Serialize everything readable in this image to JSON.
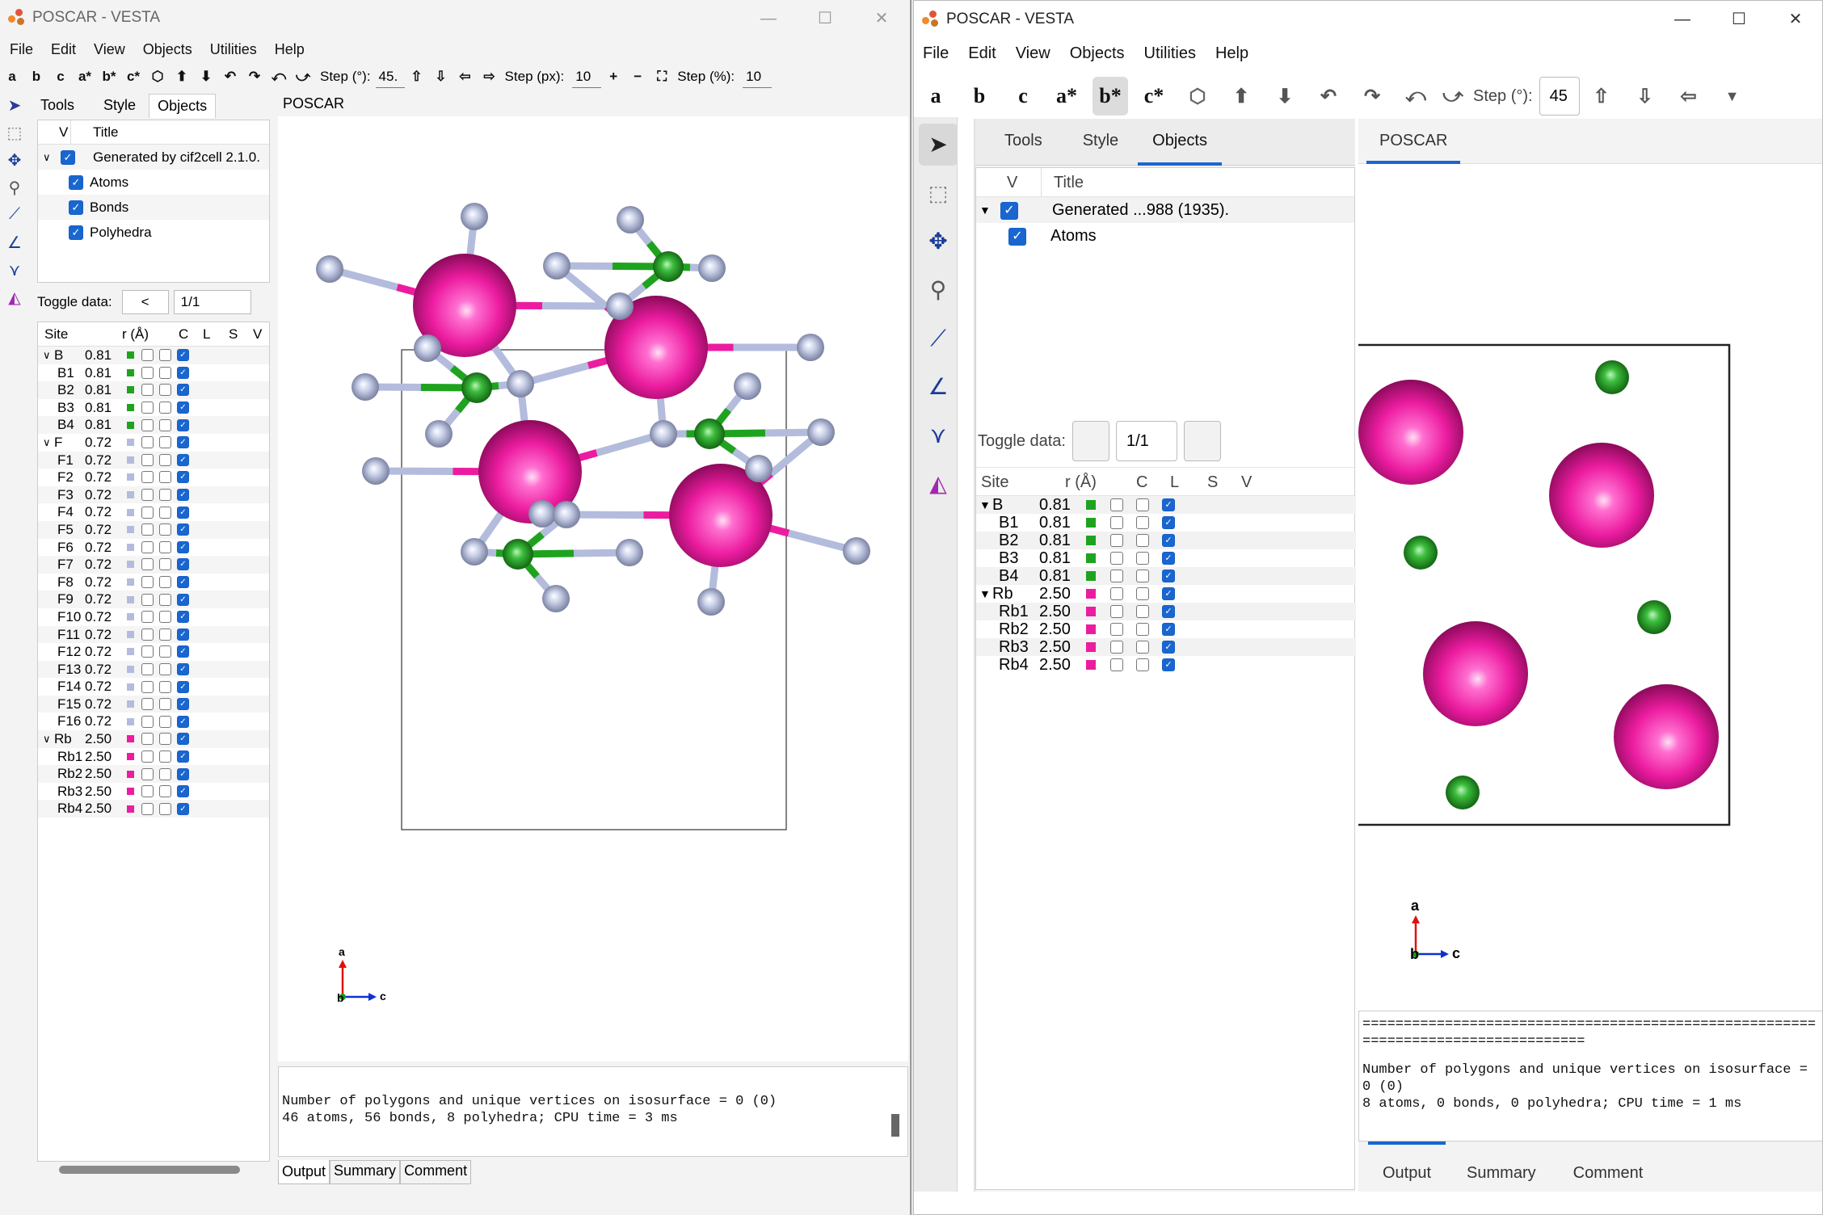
{
  "left": {
    "title": "POSCAR - VESTA",
    "menu": [
      "File",
      "Edit",
      "View",
      "Objects",
      "Utilities",
      "Help"
    ],
    "toolbar": {
      "axes": [
        "a",
        "b",
        "c",
        "a*",
        "b*",
        "c*"
      ],
      "step_deg_label": "Step (°):",
      "step_deg_value": "45.",
      "step_px_label": "Step (px):",
      "step_px_value": "10",
      "step_pct_label": "Step (%):",
      "step_pct_value": "10"
    },
    "tabs": [
      "Tools",
      "Style",
      "Objects"
    ],
    "objects_header": {
      "v": "V",
      "title": "Title"
    },
    "objects": [
      {
        "label": "Generated by cif2cell 2.1.0."
      },
      {
        "label": "Atoms"
      },
      {
        "label": "Bonds"
      },
      {
        "label": "Polyhedra"
      }
    ],
    "toggle_label": "Toggle data:",
    "toggle_prev": "<",
    "toggle_value": "1/1",
    "site_header": {
      "site": "Site",
      "r": "r (Å)",
      "c": "C",
      "l": "L",
      "s": "S",
      "v": "V"
    },
    "sites": [
      {
        "name": "B",
        "r": "0.81",
        "group": true,
        "color": "#1fa31f"
      },
      {
        "name": "B1",
        "r": "0.81",
        "color": "#1fa31f"
      },
      {
        "name": "B2",
        "r": "0.81",
        "color": "#1fa31f"
      },
      {
        "name": "B3",
        "r": "0.81",
        "color": "#1fa31f"
      },
      {
        "name": "B4",
        "r": "0.81",
        "color": "#1fa31f"
      },
      {
        "name": "F",
        "r": "0.72",
        "group": true,
        "color": "#b3bcdc"
      },
      {
        "name": "F1",
        "r": "0.72",
        "color": "#b3bcdc"
      },
      {
        "name": "F2",
        "r": "0.72",
        "color": "#b3bcdc"
      },
      {
        "name": "F3",
        "r": "0.72",
        "color": "#b3bcdc"
      },
      {
        "name": "F4",
        "r": "0.72",
        "color": "#b3bcdc"
      },
      {
        "name": "F5",
        "r": "0.72",
        "color": "#b3bcdc"
      },
      {
        "name": "F6",
        "r": "0.72",
        "color": "#b3bcdc"
      },
      {
        "name": "F7",
        "r": "0.72",
        "color": "#b3bcdc"
      },
      {
        "name": "F8",
        "r": "0.72",
        "color": "#b3bcdc"
      },
      {
        "name": "F9",
        "r": "0.72",
        "color": "#b3bcdc"
      },
      {
        "name": "F10",
        "r": "0.72",
        "color": "#b3bcdc"
      },
      {
        "name": "F11",
        "r": "0.72",
        "color": "#b3bcdc"
      },
      {
        "name": "F12",
        "r": "0.72",
        "color": "#b3bcdc"
      },
      {
        "name": "F13",
        "r": "0.72",
        "color": "#b3bcdc"
      },
      {
        "name": "F14",
        "r": "0.72",
        "color": "#b3bcdc"
      },
      {
        "name": "F15",
        "r": "0.72",
        "color": "#b3bcdc"
      },
      {
        "name": "F16",
        "r": "0.72",
        "color": "#b3bcdc"
      },
      {
        "name": "Rb",
        "r": "2.50",
        "group": true,
        "color": "#ec1ca0"
      },
      {
        "name": "Rb1",
        "r": "2.50",
        "color": "#ec1ca0"
      },
      {
        "name": "Rb2",
        "r": "2.50",
        "color": "#ec1ca0"
      },
      {
        "name": "Rb3",
        "r": "2.50",
        "color": "#ec1ca0"
      },
      {
        "name": "Rb4",
        "r": "2.50",
        "color": "#ec1ca0"
      }
    ],
    "viewer_tab": "POSCAR",
    "axis_a": "a",
    "axis_b": "b",
    "axis_c": "c",
    "output_lines": [
      "Number of polygons and unique vertices on isosurface = 0 (0)",
      "46 atoms, 56 bonds, 8 polyhedra; CPU time = 3 ms"
    ],
    "bottom_tabs": [
      "Output",
      "Summary",
      "Comment"
    ]
  },
  "right": {
    "title": "POSCAR - VESTA",
    "menu": [
      "File",
      "Edit",
      "View",
      "Objects",
      "Utilities",
      "Help"
    ],
    "toolbar": {
      "axes": [
        "a",
        "b",
        "c",
        "a*",
        "b*",
        "c*"
      ],
      "step_deg_label": "Step (°):",
      "step_deg_value": "45"
    },
    "tabs": [
      "Tools",
      "Style",
      "Objects"
    ],
    "objects_header": {
      "v": "V",
      "title": "Title"
    },
    "objects": [
      {
        "label": "Generated ...988 (1935)."
      },
      {
        "label": "Atoms"
      }
    ],
    "toggle_label": "Toggle data:",
    "toggle_value": "1/1",
    "site_header": {
      "site": "Site",
      "r": "r (Å)",
      "c": "C",
      "l": "L",
      "s": "S",
      "v": "V"
    },
    "sites": [
      {
        "name": "B",
        "r": "0.81",
        "group": true,
        "color": "#1fa31f"
      },
      {
        "name": "B1",
        "r": "0.81",
        "color": "#1fa31f"
      },
      {
        "name": "B2",
        "r": "0.81",
        "color": "#1fa31f"
      },
      {
        "name": "B3",
        "r": "0.81",
        "color": "#1fa31f"
      },
      {
        "name": "B4",
        "r": "0.81",
        "color": "#1fa31f"
      },
      {
        "name": "Rb",
        "r": "2.50",
        "group": true,
        "color": "#ec1ca0"
      },
      {
        "name": "Rb1",
        "r": "2.50",
        "color": "#ec1ca0"
      },
      {
        "name": "Rb2",
        "r": "2.50",
        "color": "#ec1ca0"
      },
      {
        "name": "Rb3",
        "r": "2.50",
        "color": "#ec1ca0"
      },
      {
        "name": "Rb4",
        "r": "2.50",
        "color": "#ec1ca0"
      }
    ],
    "viewer_tab": "POSCAR",
    "axis_a": "a",
    "axis_b": "b",
    "axis_c": "c",
    "output_rule": "==================================================================================",
    "output_lines": [
      "Number of polygons and unique vertices on isosurface = 0 (0)",
      "8 atoms, 0 bonds, 0 polyhedra; CPU time = 1 ms"
    ],
    "bottom_tabs": [
      "Output",
      "Summary",
      "Comment"
    ]
  },
  "colors": {
    "rb": "#ec1ca0",
    "b": "#1fa31f",
    "f": "#b3bcdc",
    "accent": "#1a66d0"
  }
}
